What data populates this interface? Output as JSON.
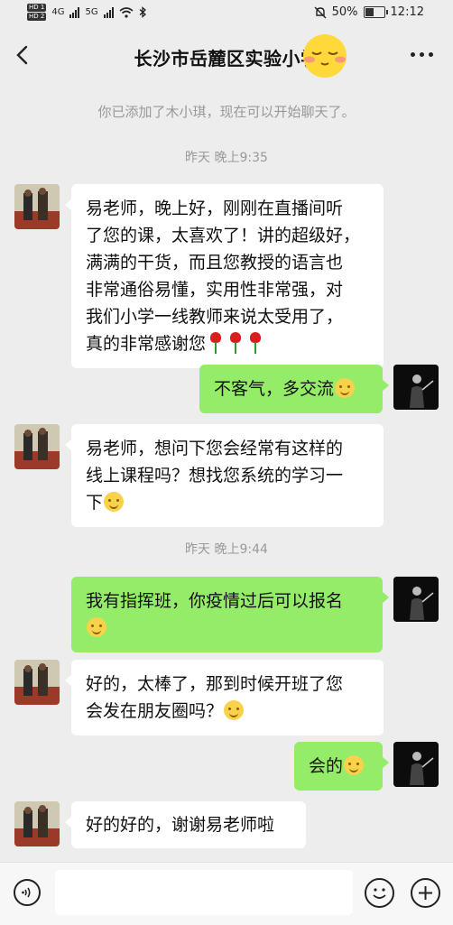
{
  "status_bar": {
    "hd1": "HD 1",
    "hd2": "HD 2",
    "net1": "4G",
    "net2": "5G",
    "battery_percent": "50%",
    "battery_level": 0.5,
    "time": "12:12"
  },
  "header": {
    "title": "长沙市岳麓区实验小学"
  },
  "system_notice": "你已添加了木小琪，现在可以开始聊天了。",
  "timestamps": [
    "昨天 晚上9:35",
    "昨天 晚上9:44"
  ],
  "messages": [
    {
      "side": "left",
      "lines": [
        "易老师，晚上好，刚刚在直播间听",
        "了您的课，太喜欢了！讲的超级好，",
        "满满的干货，而且您教授的语言也",
        "非常通俗易懂，实用性非常强，对",
        "我们小学一线教师来说太受用了，",
        "真的非常感谢您"
      ],
      "emoji": "rose-icon x3"
    },
    {
      "side": "right",
      "lines": [
        "不客气，多交流"
      ],
      "emoji": "smile-icon"
    },
    {
      "side": "left",
      "lines": [
        "易老师，想问下您会经常有这样的",
        "线上课程吗？想找您系统的学习一",
        "下"
      ],
      "emoji": "smile-icon"
    },
    {
      "side": "right",
      "lines": [
        "我有指挥班，你疫情过后可以报名"
      ],
      "emoji": "smile-icon"
    },
    {
      "side": "left",
      "lines": [
        "好的，太棒了，那到时候开班了您",
        "会发在朋友圈吗？"
      ],
      "emoji": "smile-icon"
    },
    {
      "side": "right",
      "lines": [
        "会的"
      ],
      "emoji": "grin-icon"
    },
    {
      "side": "left",
      "lines": [
        "好的好的，谢谢易老师啦"
      ],
      "emoji": ""
    }
  ],
  "colors": {
    "background": "#ededed",
    "bubble_self": "#95ec69",
    "bubble_other": "#ffffff"
  }
}
